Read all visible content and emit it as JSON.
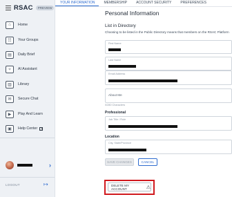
{
  "brand": {
    "name": "RSAC",
    "badge": "PREVIEW"
  },
  "sidebar": {
    "items": [
      {
        "label": "Home",
        "icon": "home-icon"
      },
      {
        "label": "Your Groups",
        "icon": "groups-icon"
      },
      {
        "label": "Daily Brief",
        "icon": "brief-icon"
      },
      {
        "label": "AI Assistant",
        "icon": "ai-assistant-icon"
      },
      {
        "label": "Library",
        "icon": "library-icon"
      },
      {
        "label": "Secure Chat",
        "icon": "chat-icon"
      },
      {
        "label": "Play And Learn",
        "icon": "play-icon"
      },
      {
        "label": "Help Center",
        "icon": "help-icon"
      }
    ],
    "logout": "LOGOUT"
  },
  "tabs": [
    "YOUR INFORMATION",
    "MEMBERSHIP",
    "ACCOUNT SECURITY",
    "PREFERENCES"
  ],
  "page": {
    "title": "Personal Information",
    "directory_heading": "List in Directory",
    "directory_desc": "Choosing to be listed in the Public Directory means that members on the RSAC Platform",
    "fields": {
      "first_name": "First Name",
      "last_name": "Last Name",
      "email": "Email Address",
      "about": "About Me",
      "counter": "0/280 Characters",
      "professional_heading": "Professional",
      "job_title": "Job Title / Role",
      "location_heading": "Location",
      "city": "City, State/Province"
    },
    "buttons": {
      "save": "SAVE CHANGES",
      "cancel": "CANCEL",
      "delete": "DELETE MY ACCOUNT"
    }
  },
  "colors": {
    "accent": "#2d6bcf",
    "highlight": "#d0181d"
  }
}
